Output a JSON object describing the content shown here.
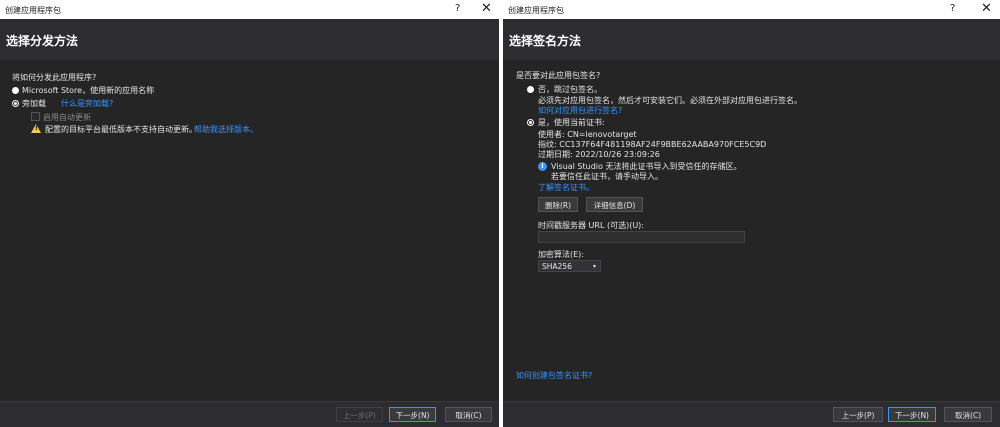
{
  "left": {
    "title": "创建应用程序包",
    "help": "?",
    "close": "✕",
    "heading": "选择分发方法",
    "question": "将如何分发此应用程序?",
    "option1": "Microsoft Store，使用新的应用名称",
    "option2": "旁加载",
    "option2_link": "什么是旁加载?",
    "checkbox": "启用自动更新",
    "warning": "配置的目标平台最低版本不支持自动更新。",
    "warning_link": "帮助我选择版本。",
    "btn_prev": "上一步(P)",
    "btn_next": "下一步(N)",
    "btn_cancel": "取消(C)"
  },
  "right": {
    "title": "创建应用程序包",
    "help": "?",
    "close": "✕",
    "heading": "选择签名方法",
    "question": "是否要对此应用包签名?",
    "opt_no": "否，跳过包签名。",
    "opt_no_desc": "必须先对应用包签名，然后才可安装它们。必须在外部对应用包进行签名。",
    "opt_no_link": "如何对应用包进行签名?",
    "opt_yes": "是，使用当前证书:",
    "issued_to": "使用者: CN=lenovotarget",
    "thumbprint": "指纹: CC137F64F481198AF24F9BBE62AABA970FCE5C9D",
    "expires": "过期日期: 2022/10/26 23:09:26",
    "info_line1": "Visual Studio 无法将此证书导入到受信任的存储区。",
    "info_line2": "若要信任此证书，请手动导入。",
    "learn_link": "了解签名证书。",
    "btn_delete": "删除(R)",
    "btn_details": "详细信息(D)",
    "timestamp_label": "时间戳服务器 URL (可选)(U):",
    "timestamp_value": "",
    "algo_label": "加密算法(E):",
    "algo_value": "SHA256",
    "bottom_link": "如何创建包签名证书?",
    "btn_prev": "上一步(P)",
    "btn_next": "下一步(N)",
    "btn_cancel": "取消(C)"
  },
  "colors": {
    "accent": "#3794ff",
    "background": "#252526",
    "warning": "#f2c94c"
  },
  "icons": {
    "warning": "warning-icon",
    "info": "info-icon",
    "caret": "chevron-down-icon"
  }
}
